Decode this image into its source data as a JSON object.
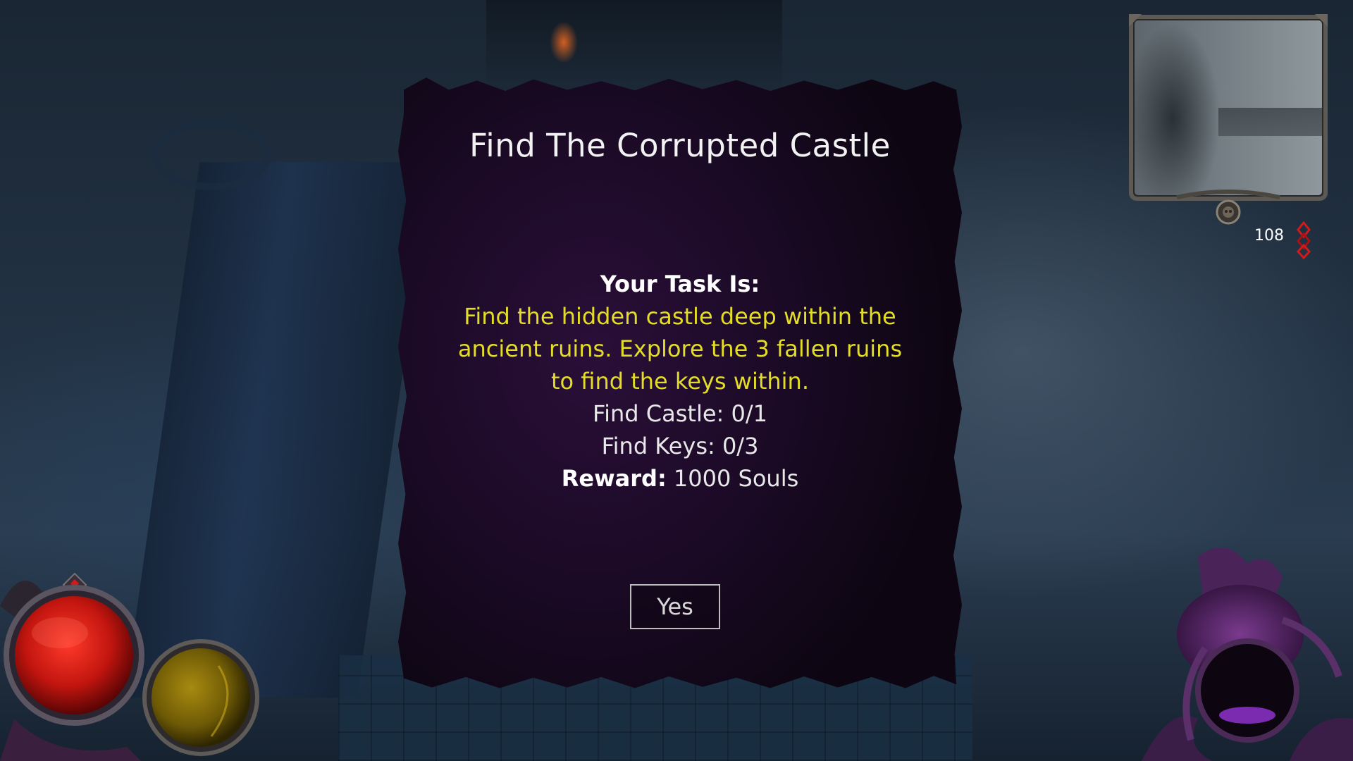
{
  "quest": {
    "title": "Find The Corrupted Castle",
    "task_heading": "Your Task Is:",
    "task_description": "Find the hidden castle deep within the ancient ruins. Explore the 3 fallen ruins to find the keys within.",
    "objectives": [
      "Find Castle: 0/1",
      "Find Keys: 0/3"
    ],
    "reward_label": "Reward:",
    "reward_value": "1000 Souls",
    "confirm_label": "Yes"
  },
  "hud": {
    "soul_count": "108",
    "health_orb": {
      "name": "health-orb",
      "fill": 1.0,
      "color": "#c2150f"
    },
    "mana_orb": {
      "name": "mana-orb",
      "fill": 1.0,
      "color": "#8a7208"
    }
  },
  "colors": {
    "panel_bg": "#1c0a27",
    "task_text": "#e3dd27",
    "soul_icon": "#d11a1a"
  },
  "icons": {
    "minimap_emblem": "skull-emblem-icon",
    "soul": "soul-diamond-icon"
  }
}
